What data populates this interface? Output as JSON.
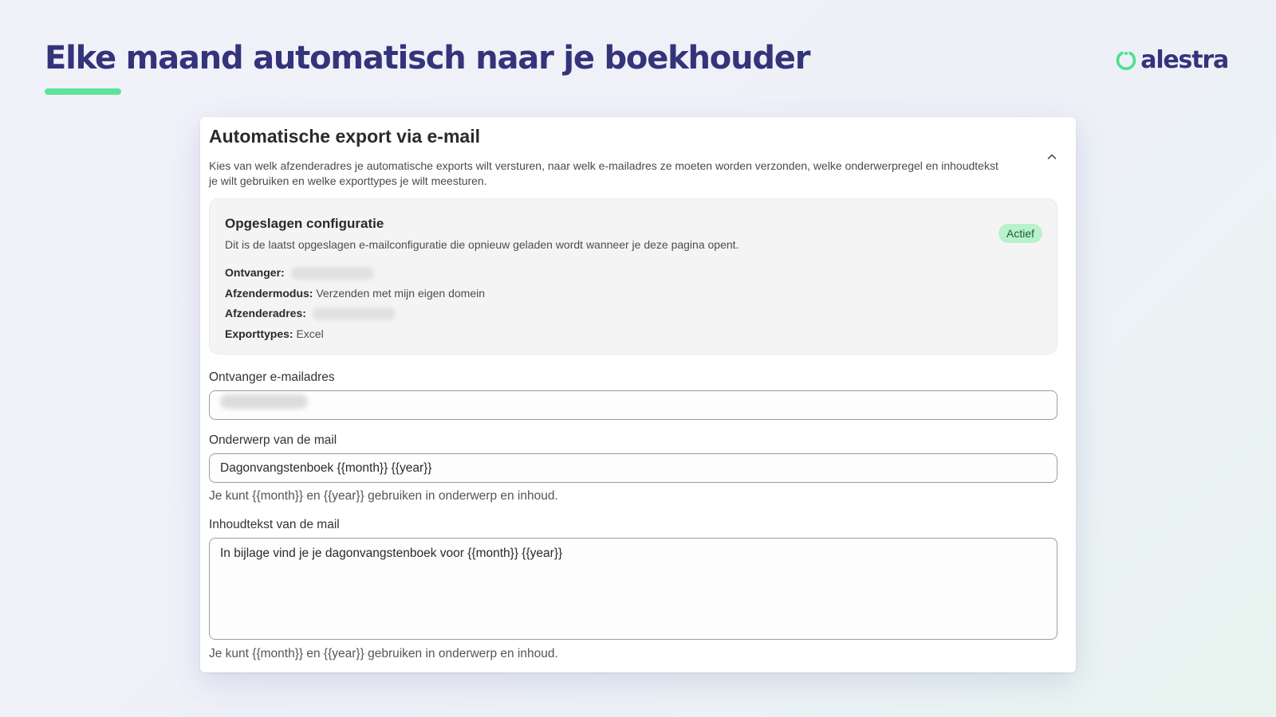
{
  "slide": {
    "headline": "Elke maand automatisch naar je boekhouder",
    "accent_color": "#5ee49a",
    "headline_color": "#33347a"
  },
  "brand": {
    "name": "alestra",
    "icon": "alestra-logo-icon"
  },
  "card": {
    "title": "Automatische export via e-mail",
    "description": "Kies van welk afzenderadres je automatische exports wilt versturen, naar welk e-mailadres ze moeten worden verzonden, welke onderwerpregel en inhoudtekst je wilt gebruiken en welke exporttypes je wilt meesturen.",
    "collapse_icon": "chevron-up-icon",
    "saved_config": {
      "title": "Opgeslagen configuratie",
      "description": "Dit is de laatst opgeslagen e-mailconfiguratie die opnieuw geladen wordt wanneer je deze pagina opent.",
      "status": "Actief",
      "status_color": "#b8f2cc",
      "rows": {
        "recipient_label": "Ontvanger:",
        "recipient_value": "",
        "sender_mode_label": "Afzendermodus:",
        "sender_mode_value": "Verzenden met mijn eigen domein",
        "sender_address_label": "Afzenderadres:",
        "sender_address_value": "",
        "export_types_label": "Exporttypes:",
        "export_types_value": "Excel"
      }
    },
    "form": {
      "recipient_label": "Ontvanger e-mailadres",
      "recipient_value": "",
      "subject_label": "Onderwerp van de mail",
      "subject_value": "Dagonvangstenboek {{month}} {{year}}",
      "subject_hint": "Je kunt {{month}} en {{year}} gebruiken in onderwerp en inhoud.",
      "body_label": "Inhoudtekst van de mail",
      "body_value": "In bijlage vind je je dagonvangstenboek voor {{month}} {{year}}",
      "body_hint": "Je kunt {{month}} en {{year}} gebruiken in onderwerp en inhoud."
    }
  }
}
